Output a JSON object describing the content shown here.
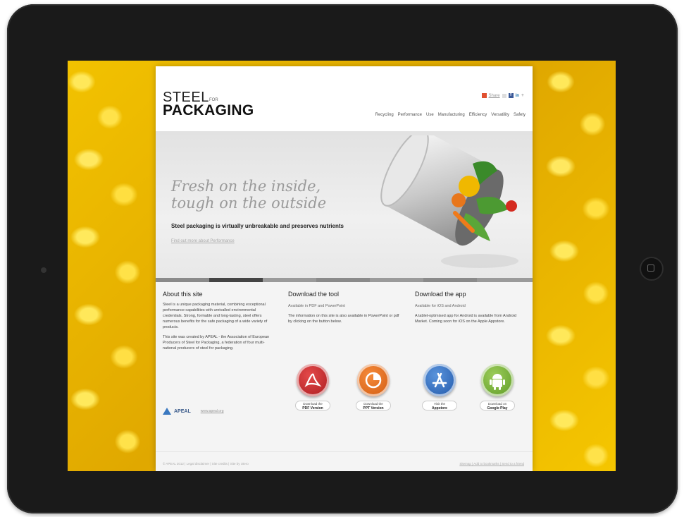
{
  "site": {
    "logo_top": "STEEL",
    "logo_for": "FOR",
    "logo_main": "PACKAGING",
    "share_label": "Share",
    "nav": [
      "Recycling",
      "Performance",
      "Use",
      "Manufacturing",
      "Efficiency",
      "Versatility",
      "Safety"
    ]
  },
  "hero": {
    "heading_line1": "Fresh on the inside,",
    "heading_line2": "tough on the outside",
    "subheading": "Steel packaging is virtually unbreakable and preserves nutrients",
    "link": "Find out more about Performance"
  },
  "about": {
    "title": "About this site",
    "para1": "Steel is a unique packaging material, combining exceptional performance capabilities with unrivalled environmental credentials. Strong, formable and long-lasting, steel offers numerous benefits for the safe packaging of a wide variety of products.",
    "para2": "This site was created by APEAL - the Association of European Producers of Steel for Packaging, a federation of four multi-national producers of steel for packaging.",
    "logo_label": "APEAL",
    "logo_link": "www.apeal.org"
  },
  "tool": {
    "title": "Download the tool",
    "available": "Available in PDF and PowerPoint",
    "para": "The information on this site is also available in PowerPoint or pdf by clicking on the button below.",
    "btn_pdf_line1": "Download the",
    "btn_pdf_line2": "PDF Version",
    "btn_ppt_line1": "Download the",
    "btn_ppt_line2": "PPT Version"
  },
  "app": {
    "title": "Download the app",
    "available": "Available for iOS and Android",
    "para": "A tablet-optimised app for Android is available from Android Market. Coming soon for iOS on the Apple Appstore.",
    "btn_ios_line1": "Visit the",
    "btn_ios_line2": "Appstore",
    "btn_android_line1": "Download on",
    "btn_android_line2": "Google Play"
  },
  "footer": {
    "left": "© APEAL 2012 | Legal disclaimer | Site credits | Site by Utero",
    "right": "Sitemap | Add to bookmarks | Send to a friend"
  },
  "colors": {
    "pdf": "#c8262a",
    "ppt": "#e86b1c",
    "ios": "#2f6fc2",
    "android": "#79b43a",
    "progress_active": "#444444"
  },
  "icons": {
    "pdf": "acrobat-icon",
    "ppt": "powerpoint-icon",
    "ios": "app-store-icon",
    "android": "android-robot-icon"
  }
}
